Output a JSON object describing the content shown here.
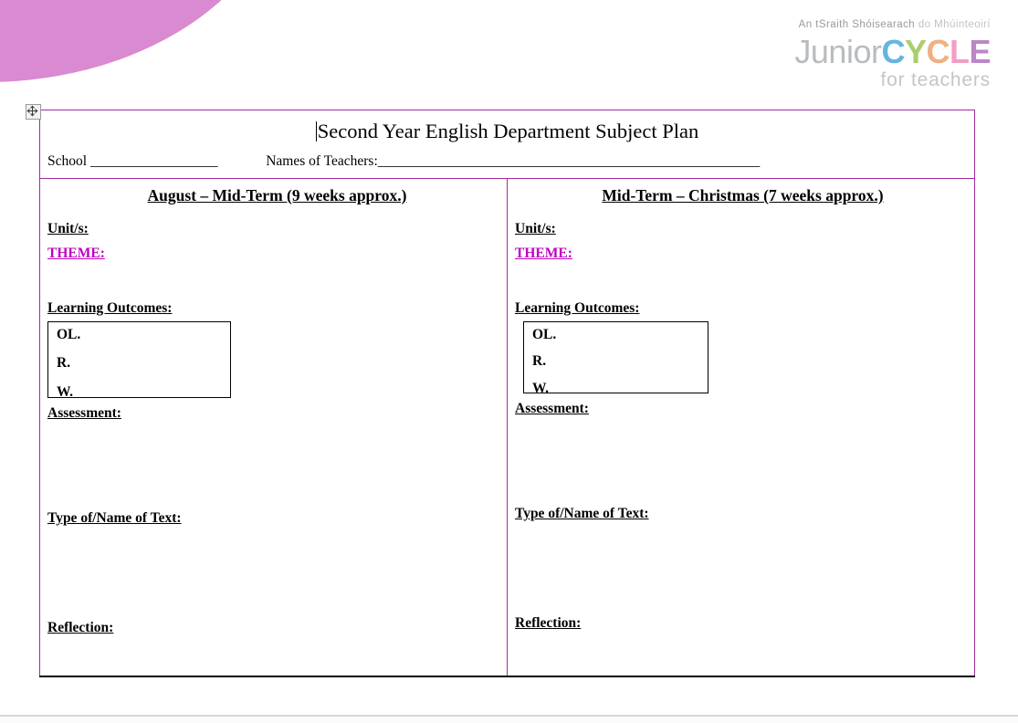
{
  "branding": {
    "blob_color": "#d98ad0",
    "tagline_strong": "An tSraith Shóisearach",
    "tagline_light": "do Mhúinteoirí",
    "word_junior": "Junior",
    "word_c1": "C",
    "word_y": "Y",
    "word_c2": "C",
    "word_l": "L",
    "word_e": "E",
    "subline": "for teachers",
    "colors": {
      "c1": "#63b6e0",
      "y": "#a9cf6c",
      "c2": "#f0b183",
      "l": "#f29ec4",
      "e": "#bb86c6",
      "junior": "#b9bcbe"
    }
  },
  "document": {
    "title": "Second Year English Department Subject Plan",
    "school_label": "School",
    "school_value": "__________________",
    "teachers_label": "Names of Teachers:",
    "teachers_value": "______________________________________________________",
    "table_border_color": "#a12ba1",
    "theme_color": "#c000c0"
  },
  "columns": [
    {
      "heading": "August – Mid-Term (9 weeks approx.)",
      "units_label": "Unit/s:",
      "theme_label": "THEME:",
      "learning_outcomes_label": "Learning Outcomes:",
      "outcomes": [
        "OL.",
        "R.",
        "W."
      ],
      "assessment_label": "Assessment:",
      "text_label": "Type of/Name of Text:",
      "reflection_label": "Reflection:"
    },
    {
      "heading": "Mid-Term – Christmas (7 weeks approx.)",
      "units_label": "Unit/s:",
      "theme_label": "THEME:",
      "learning_outcomes_label": "Learning Outcomes:",
      "outcomes": [
        "OL.",
        "R.",
        "W."
      ],
      "assessment_label": "Assessment:",
      "text_label": "Type of/Name of Text:",
      "reflection_label": "Reflection:"
    }
  ]
}
